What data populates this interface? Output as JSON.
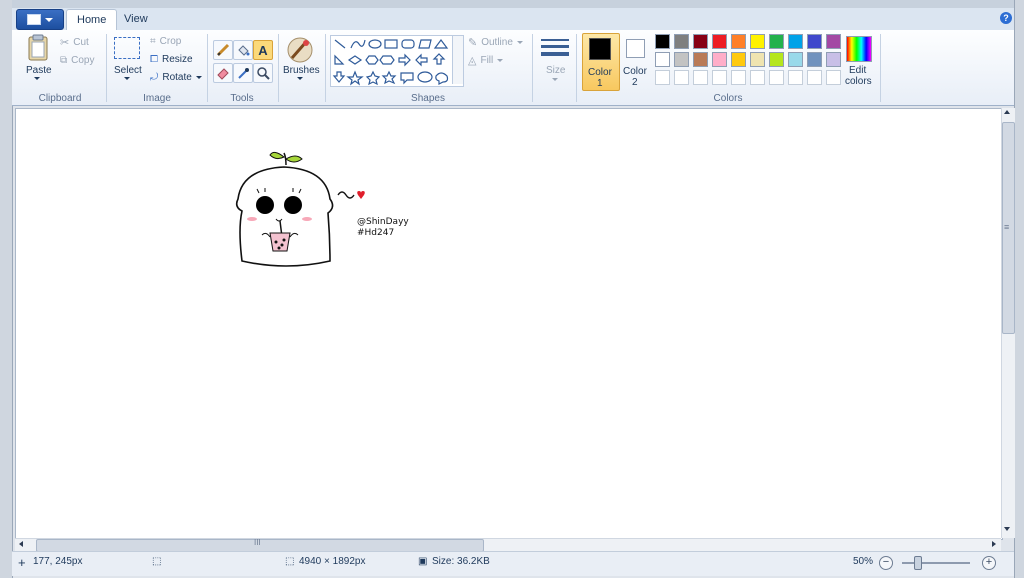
{
  "app_menu": {
    "icon": "paint-document-icon"
  },
  "tabs": [
    {
      "label": "Home"
    },
    {
      "label": "View"
    }
  ],
  "clipboard": {
    "paste_label": "Paste",
    "cut_label": "Cut",
    "copy_label": "Copy",
    "group_label": "Clipboard"
  },
  "image": {
    "select_label": "Select",
    "crop_label": "Crop",
    "resize_label": "Resize",
    "rotate_label": "Rotate",
    "group_label": "Image"
  },
  "tools": {
    "group_label": "Tools",
    "items": [
      "pencil-icon",
      "fill-bucket-icon",
      "text-icon",
      "eraser-icon",
      "color-picker-icon",
      "magnifier-icon"
    ]
  },
  "brushes": {
    "label": "Brushes"
  },
  "shapes": {
    "outline_label": "Outline",
    "fill_label": "Fill",
    "group_label": "Shapes"
  },
  "size": {
    "label": "Size"
  },
  "colors": {
    "color1_label": "Color",
    "color1_num": "1",
    "color2_label": "Color",
    "color2_num": "2",
    "edit_label_1": "Edit",
    "edit_label_2": "colors",
    "group_label": "Colors",
    "color1_value": "#000000",
    "color2_value": "#ffffff",
    "row1": [
      "#000000",
      "#7f7f7f",
      "#880015",
      "#ed1c24",
      "#ff7f27",
      "#fff200",
      "#22b14c",
      "#00a2e8",
      "#3f48cc",
      "#a349a4"
    ],
    "row2": [
      "#ffffff",
      "#c3c3c3",
      "#b97a57",
      "#ffaec9",
      "#ffc90e",
      "#efe4b0",
      "#b5e61d",
      "#99d9ea",
      "#7092be",
      "#c8bfe7"
    ]
  },
  "canvas": {
    "signature_line1": "@ShinDayy",
    "signature_line2": "#Hd247"
  },
  "status": {
    "cursor_pos": "177, 245px",
    "dimensions": "4940 × 1892px",
    "size": "Size: 36.2KB",
    "zoom": "50%"
  },
  "hscroll_grip": "III",
  "vscroll_grip": "≡"
}
